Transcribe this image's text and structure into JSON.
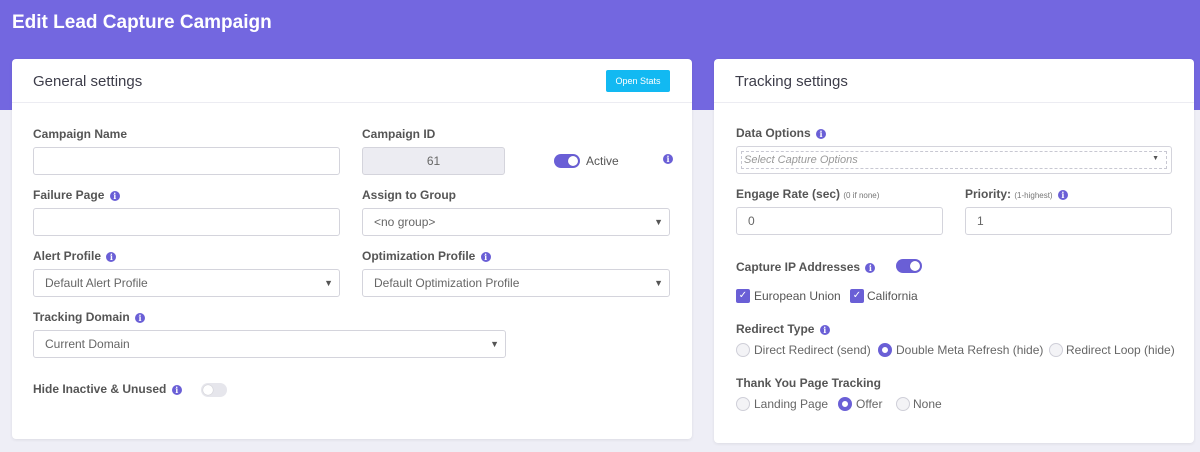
{
  "header": {
    "title": "Edit Lead Capture Campaign"
  },
  "general": {
    "title": "General settings",
    "open_stats": "Open Stats",
    "campaign_name_label": "Campaign Name",
    "campaign_name_value": "",
    "campaign_id_label": "Campaign ID",
    "campaign_id_value": "61",
    "active_label": "Active",
    "active_on": true,
    "failure_page_label": "Failure Page",
    "failure_page_value": "",
    "assign_group_label": "Assign to Group",
    "assign_group_value": "<no group>",
    "alert_profile_label": "Alert Profile",
    "alert_profile_value": "Default Alert Profile",
    "optimization_profile_label": "Optimization Profile",
    "optimization_profile_value": "Default Optimization Profile",
    "tracking_domain_label": "Tracking Domain",
    "tracking_domain_value": "Current Domain",
    "hide_inactive_label": "Hide Inactive & Unused",
    "hide_inactive_on": false
  },
  "tracking": {
    "title": "Tracking settings",
    "data_options_label": "Data Options",
    "data_options_placeholder": "Select Capture Options",
    "engage_rate_label": "Engage Rate (sec)",
    "engage_rate_hint": "(0 if none)",
    "engage_rate_value": "0",
    "priority_label": "Priority:",
    "priority_hint": "(1-highest)",
    "priority_value": "1",
    "capture_ip_label": "Capture IP Addresses",
    "capture_ip_on": true,
    "checks": [
      "European Union",
      "California"
    ],
    "redirect_type_label": "Redirect Type",
    "redirect_options": [
      "Direct Redirect (send)",
      "Double Meta Refresh (hide)",
      "Redirect Loop (hide)"
    ],
    "redirect_selected": "Double Meta Refresh (hide)",
    "thank_you_label": "Thank You Page Tracking",
    "thank_you_options": [
      "Landing Page",
      "Offer",
      "None"
    ],
    "thank_you_selected": "Offer"
  },
  "icons": [
    "info-icon",
    "chevron-down-icon",
    "check-icon"
  ],
  "colors": {
    "accent": "#7367e0",
    "button": "#12b9f2",
    "toggle": "#6a5fd6"
  }
}
